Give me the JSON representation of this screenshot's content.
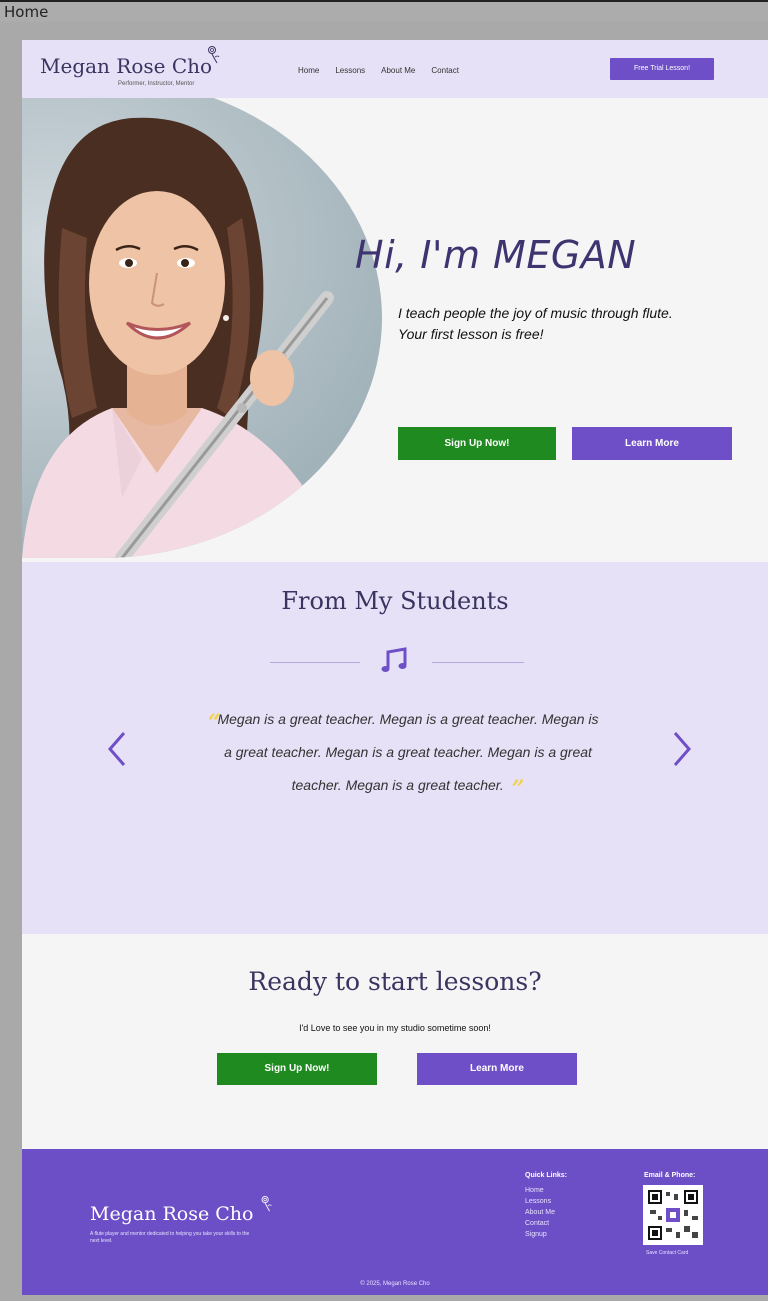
{
  "window": {
    "title": "Home"
  },
  "header": {
    "logo_name": "Megan Rose Cho",
    "logo_tagline": "Performer, Instructor, Mentor",
    "nav": [
      "Home",
      "Lessons",
      "About Me",
      "Contact"
    ],
    "cta": "Free Trial Lesson!"
  },
  "hero": {
    "title": "Hi, I'm MEGAN",
    "subtitle_line1": "I teach people the joy of music through flute.",
    "subtitle_line2": "Your first lesson is free!",
    "signup": "Sign Up Now!",
    "learn": "Learn More"
  },
  "testimonials": {
    "title": "From My Students",
    "quote": "Megan is a great teacher. Megan is a great teacher. Megan is a great teacher. Megan is a great teacher. Megan is a great teacher. Megan is a great teacher."
  },
  "ready": {
    "title": "Ready to start lessons?",
    "subtitle": "I'd Love to see you in my studio sometime soon!",
    "signup": "Sign Up Now!",
    "learn": "Learn More"
  },
  "footer": {
    "name": "Megan Rose Cho",
    "description": "A flute player and mentor dedicated to helping you take your skills to the next level.",
    "links_title": "Quick Links:",
    "links": [
      "Home",
      "Lessons",
      "About Me",
      "Contact",
      "Signup"
    ],
    "contact_title": "Email & Phone:",
    "save_contact": "Save Contact Card",
    "copyright": "© 2025, Megan Rose Cho"
  },
  "colors": {
    "brand_purple": "#6e4fc7",
    "lavender": "#e6e1f6",
    "green": "#1e8a1f",
    "quote_yellow": "#f2d24a"
  }
}
